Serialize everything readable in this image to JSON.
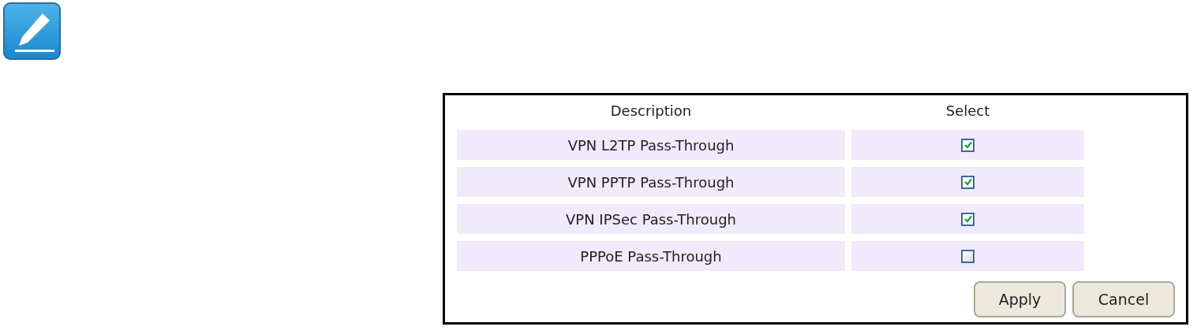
{
  "columns": [
    "Description",
    "Select"
  ],
  "rows": [
    {
      "description": "VPN L2TP Pass-Through",
      "checked": true
    },
    {
      "description": "VPN PPTP Pass-Through",
      "checked": true
    },
    {
      "description": "VPN IPSec Pass-Through",
      "checked": true
    },
    {
      "description": "PPPoE Pass-Through",
      "checked": false
    }
  ],
  "buttons": [
    "Apply",
    "Cancel"
  ]
}
